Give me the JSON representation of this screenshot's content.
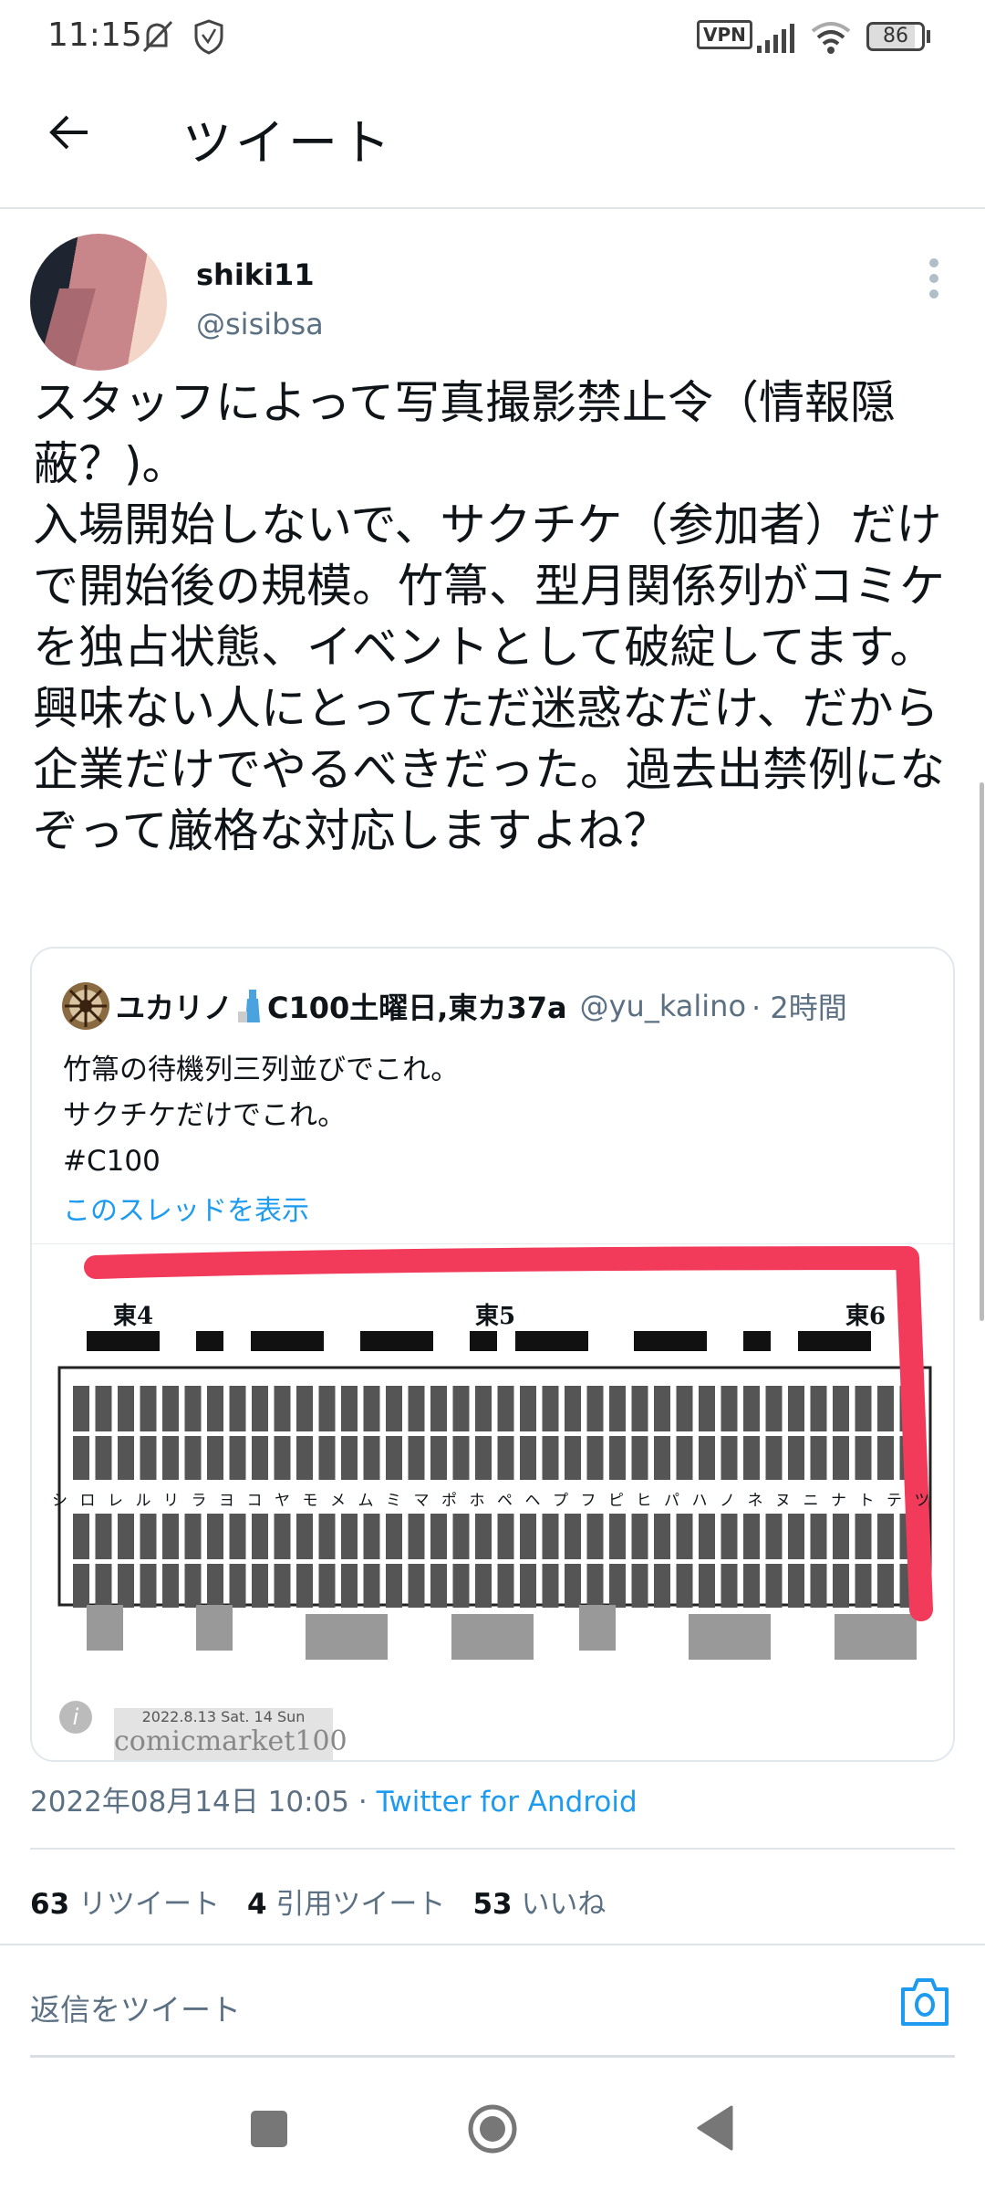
{
  "status_bar": {
    "time": "11:15",
    "vpn": "VPN",
    "battery": "86",
    "icons": [
      "mute-icon",
      "shield-icon",
      "vpn-icon",
      "signal-icon",
      "wifi-icon",
      "battery-icon"
    ]
  },
  "header": {
    "title": "ツイート",
    "back_icon": "arrow-left-icon"
  },
  "tweet": {
    "display_name": "shiki11",
    "handle": "@sisibsa",
    "text": "スタッフによって写真撮影禁止令（情報隠蔽？)。\n入場開始しないで、サクチケ（参加者）だけで開始後の規模。竹箒、型月関係列がコミケを独占状態、イベントとして破綻してます。\n興味ない人にとってただ迷惑なだけ、だから企業だけでやるべきだった。過去出禁例になぞって厳格な対応しますよね？",
    "timestamp": "2022年08月14日 10:05",
    "separator": "·",
    "source": "Twitter for Android",
    "stats": [
      {
        "count": "63",
        "label": "リツイート"
      },
      {
        "count": "4",
        "label": "引用ツイート"
      },
      {
        "count": "53",
        "label": "いいね"
      }
    ]
  },
  "quoted": {
    "display_name": "ユカリノ",
    "display_name_suffix": "C100土曜日,東カ37a",
    "handle": "@yu_kalino",
    "time": "· 2時間",
    "text": "竹箒の待機列三列並びでこれ。\nサクチケだけでこれ。\n#C100",
    "thread_link": "このスレッドを表示",
    "image": {
      "halls": [
        "東4",
        "東5",
        "東6"
      ],
      "rows": "シロレルリラヨコヤモメムミマポホペヘプフピヒパハノネヌニナトテツチタソセス",
      "banner_date": "2022.8.13 Sat. 14 Sun",
      "banner_title": "comicmarket100",
      "annotation_color": "#f23a5a"
    }
  },
  "reply": {
    "placeholder": "返信をツイート",
    "camera_icon": "camera-icon"
  },
  "colors": {
    "accent": "#1d9bf0",
    "secondary_text": "#5b7083"
  },
  "nav": {
    "buttons": [
      "recents-button",
      "home-button",
      "back-button"
    ]
  }
}
